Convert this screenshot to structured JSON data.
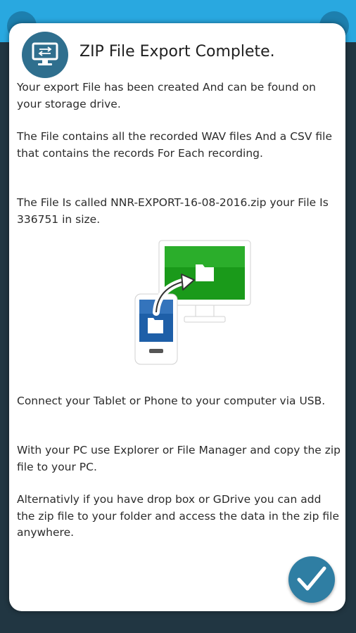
{
  "dialog": {
    "title": "ZIP File Export Complete.",
    "icon": "computer-monitor-icon",
    "paragraphs": [
      "Your export File has been created And can be found on your storage drive.",
      "The File contains all the recorded WAV files And a CSV file that contains the records For Each recording.",
      "The File Is called NNR-EXPORT-16-08-2016.zip your File Is 336751 in size.",
      "Connect your Tablet or Phone to your computer via USB.",
      "With your PC use Explorer or File Manager and copy the zip file to your PC.",
      "Alternativly if you have drop box or GDrive you can add the zip file to your folder and access the data in the zip file anywhere."
    ],
    "illustration": "phone-to-computer-transfer-icon",
    "confirm_icon": "checkmark-icon"
  },
  "colors": {
    "accent": "#2f7ea3",
    "topbar": "#29a8e0",
    "screen_green": "#1a9a1a",
    "phone_blue": "#1e5fa8"
  }
}
